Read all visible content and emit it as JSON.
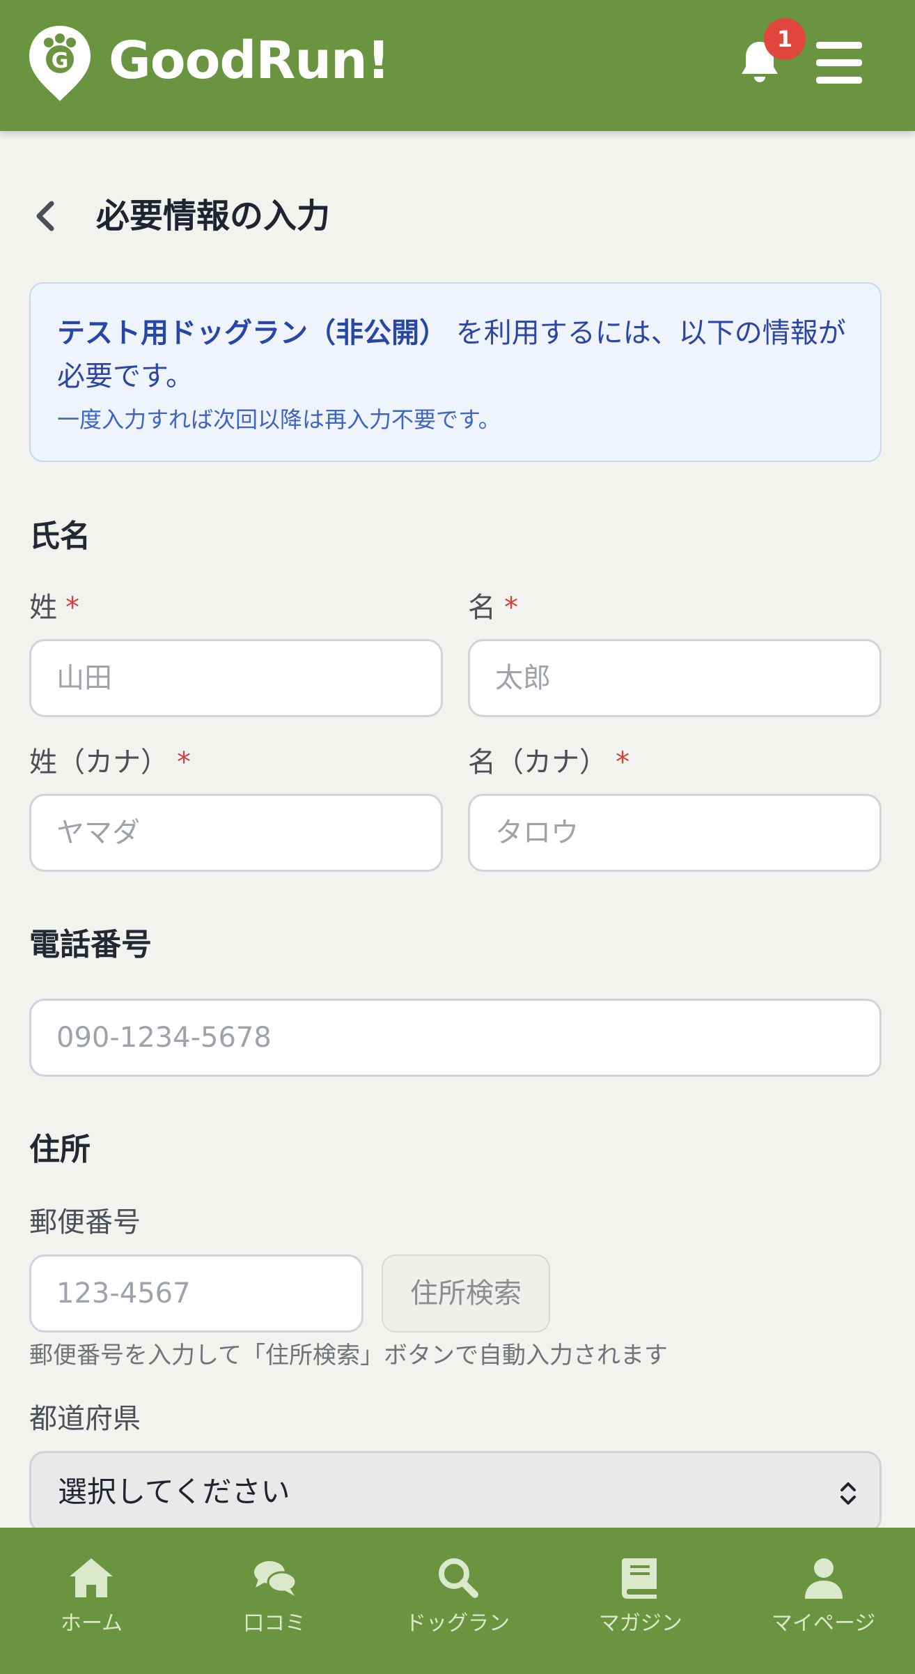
{
  "header": {
    "app_name": "GoodRun!",
    "notification_count": "1",
    "brand_color": "#6a9440"
  },
  "page": {
    "title": "必要情報の入力"
  },
  "info": {
    "dogrun_name": "テスト用ドッグラン（非公開）",
    "message": "を利用するには、以下の情報が必要です。",
    "note": "一度入力すれば次回以降は再入力不要です。"
  },
  "name_section": {
    "heading": "氏名",
    "last_name_label": "姓",
    "first_name_label": "名",
    "last_name_placeholder": "山田",
    "first_name_placeholder": "太郎",
    "last_kana_label": "姓（カナ）",
    "first_kana_label": "名（カナ）",
    "last_kana_placeholder": "ヤマダ",
    "first_kana_placeholder": "タロウ",
    "required_mark": "*"
  },
  "phone_section": {
    "heading": "電話番号",
    "placeholder": "090-1234-5678"
  },
  "address_section": {
    "heading": "住所",
    "postal_label": "郵便番号",
    "postal_placeholder": "123-4567",
    "search_button": "住所検索",
    "hint": "郵便番号を入力して「住所検索」ボタンで自動入力されます",
    "prefecture_label": "都道府県",
    "prefecture_value": "選択してください"
  },
  "tabbar": {
    "items": [
      {
        "label": "ホーム",
        "icon": "home-icon"
      },
      {
        "label": "口コミ",
        "icon": "comments-icon"
      },
      {
        "label": "ドッグラン",
        "icon": "search-icon"
      },
      {
        "label": "マガジン",
        "icon": "book-icon"
      },
      {
        "label": "マイページ",
        "icon": "user-icon"
      }
    ]
  }
}
